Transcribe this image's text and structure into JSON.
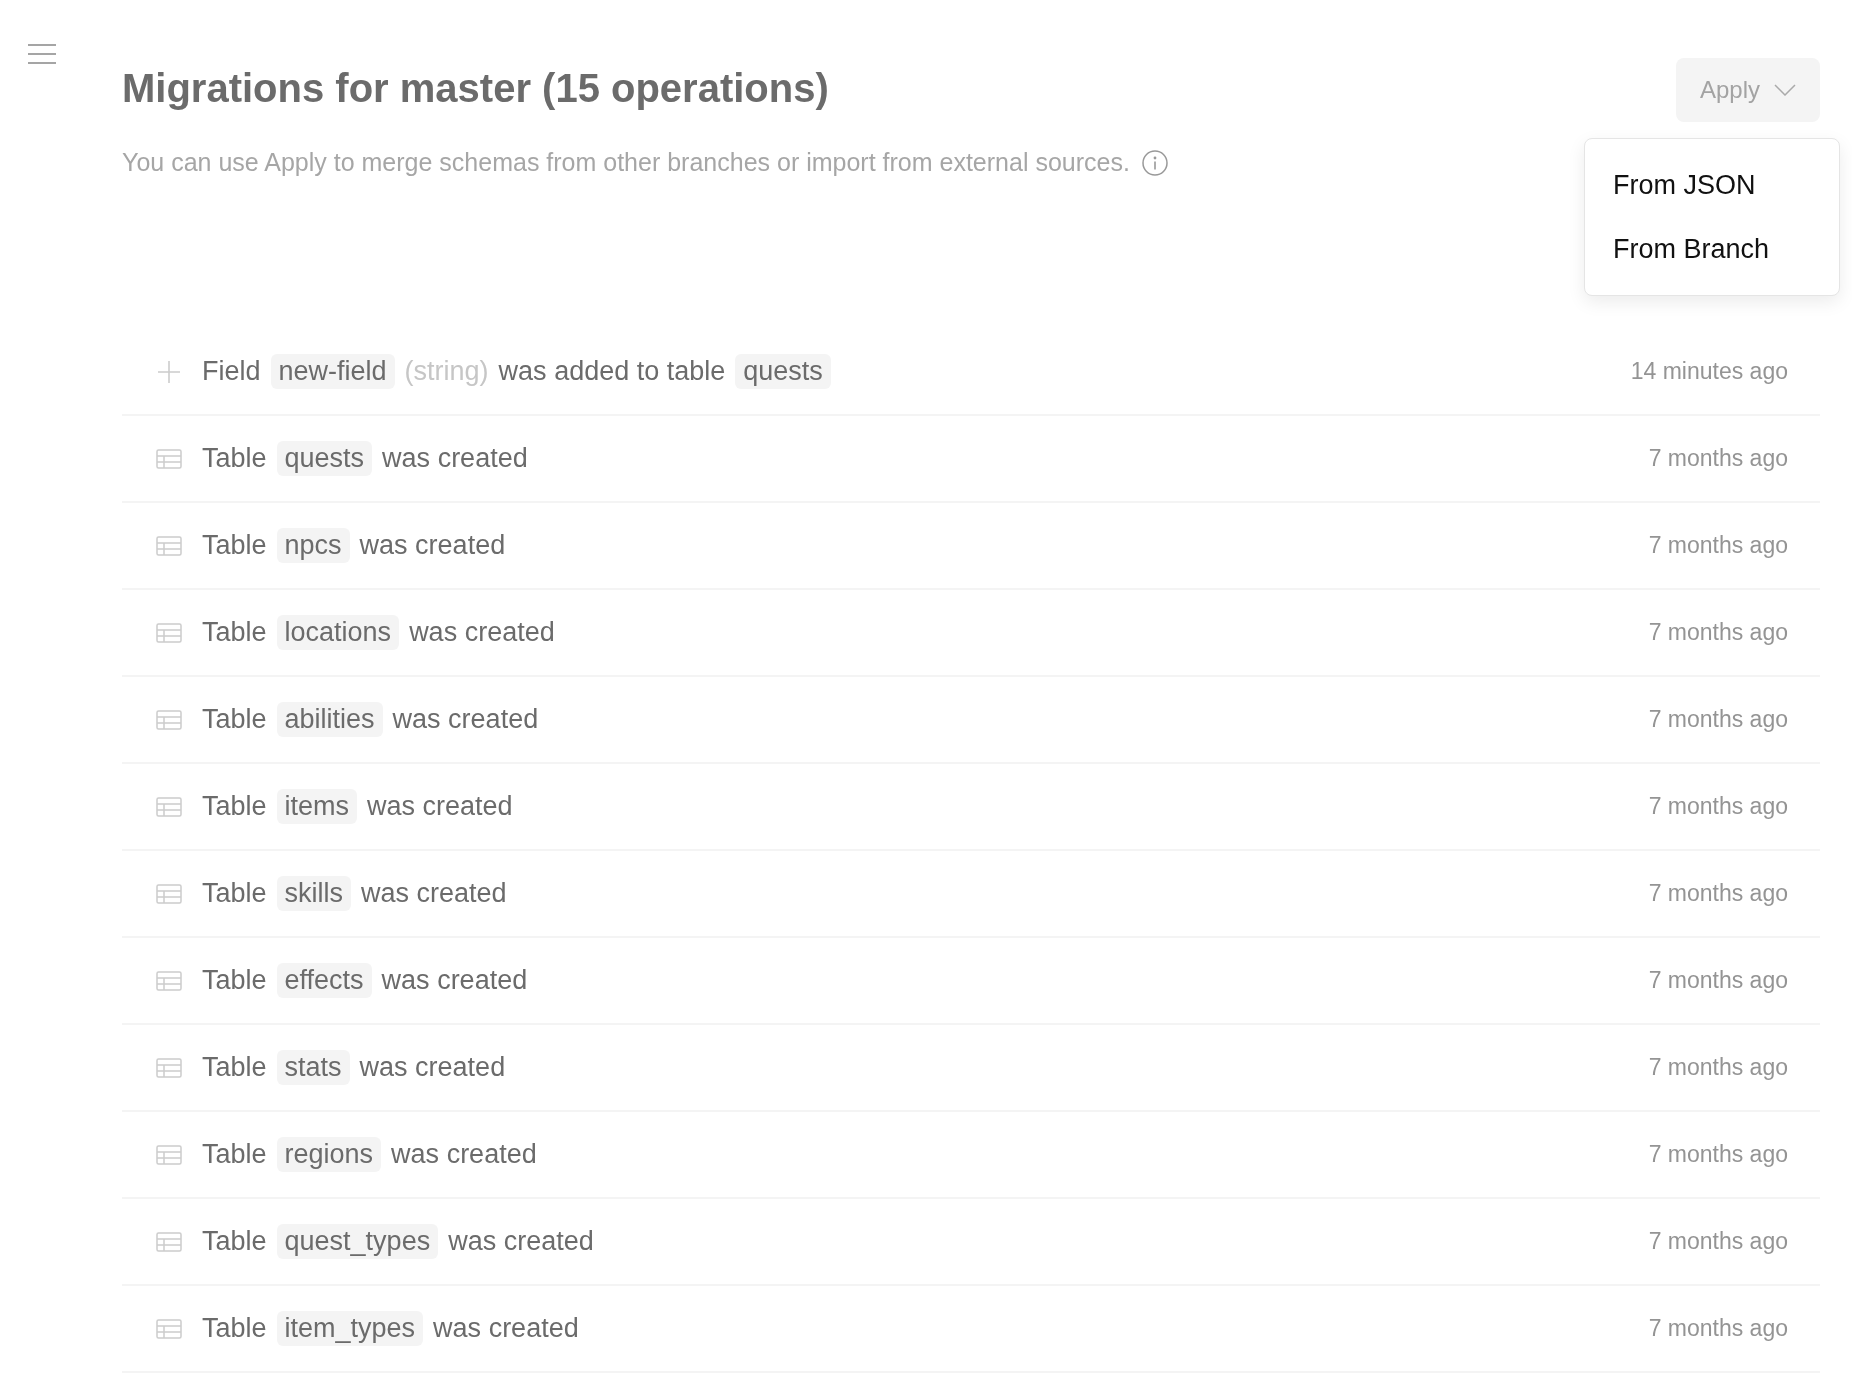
{
  "title": "Migrations for master (15 operations)",
  "subtitle": "You can use Apply to merge schemas from other branches or import from external sources.",
  "apply_button": {
    "label": "Apply",
    "expanded": true
  },
  "apply_menu": [
    "From JSON",
    "From Branch"
  ],
  "operations": [
    {
      "kind": "field_added",
      "parts": [
        {
          "kind": "text",
          "text": "Field"
        },
        {
          "kind": "code",
          "text": "new-field"
        },
        {
          "kind": "muted",
          "text": "(string)"
        },
        {
          "kind": "text",
          "text": "was added to table"
        },
        {
          "kind": "code",
          "text": "quests"
        }
      ],
      "time": "14 minutes ago"
    },
    {
      "kind": "table_created",
      "parts": [
        {
          "kind": "text",
          "text": "Table"
        },
        {
          "kind": "code",
          "text": "quests"
        },
        {
          "kind": "text",
          "text": "was created"
        }
      ],
      "time": "7 months ago"
    },
    {
      "kind": "table_created",
      "parts": [
        {
          "kind": "text",
          "text": "Table"
        },
        {
          "kind": "code",
          "text": "npcs"
        },
        {
          "kind": "text",
          "text": "was created"
        }
      ],
      "time": "7 months ago"
    },
    {
      "kind": "table_created",
      "parts": [
        {
          "kind": "text",
          "text": "Table"
        },
        {
          "kind": "code",
          "text": "locations"
        },
        {
          "kind": "text",
          "text": "was created"
        }
      ],
      "time": "7 months ago"
    },
    {
      "kind": "table_created",
      "parts": [
        {
          "kind": "text",
          "text": "Table"
        },
        {
          "kind": "code",
          "text": "abilities"
        },
        {
          "kind": "text",
          "text": "was created"
        }
      ],
      "time": "7 months ago"
    },
    {
      "kind": "table_created",
      "parts": [
        {
          "kind": "text",
          "text": "Table"
        },
        {
          "kind": "code",
          "text": "items"
        },
        {
          "kind": "text",
          "text": "was created"
        }
      ],
      "time": "7 months ago"
    },
    {
      "kind": "table_created",
      "parts": [
        {
          "kind": "text",
          "text": "Table"
        },
        {
          "kind": "code",
          "text": "skills"
        },
        {
          "kind": "text",
          "text": "was created"
        }
      ],
      "time": "7 months ago"
    },
    {
      "kind": "table_created",
      "parts": [
        {
          "kind": "text",
          "text": "Table"
        },
        {
          "kind": "code",
          "text": "effects"
        },
        {
          "kind": "text",
          "text": "was created"
        }
      ],
      "time": "7 months ago"
    },
    {
      "kind": "table_created",
      "parts": [
        {
          "kind": "text",
          "text": "Table"
        },
        {
          "kind": "code",
          "text": "stats"
        },
        {
          "kind": "text",
          "text": "was created"
        }
      ],
      "time": "7 months ago"
    },
    {
      "kind": "table_created",
      "parts": [
        {
          "kind": "text",
          "text": "Table"
        },
        {
          "kind": "code",
          "text": "regions"
        },
        {
          "kind": "text",
          "text": "was created"
        }
      ],
      "time": "7 months ago"
    },
    {
      "kind": "table_created",
      "parts": [
        {
          "kind": "text",
          "text": "Table"
        },
        {
          "kind": "code",
          "text": "quest_types"
        },
        {
          "kind": "text",
          "text": "was created"
        }
      ],
      "time": "7 months ago"
    },
    {
      "kind": "table_created",
      "parts": [
        {
          "kind": "text",
          "text": "Table"
        },
        {
          "kind": "code",
          "text": "item_types"
        },
        {
          "kind": "text",
          "text": "was created"
        }
      ],
      "time": "7 months ago"
    }
  ]
}
